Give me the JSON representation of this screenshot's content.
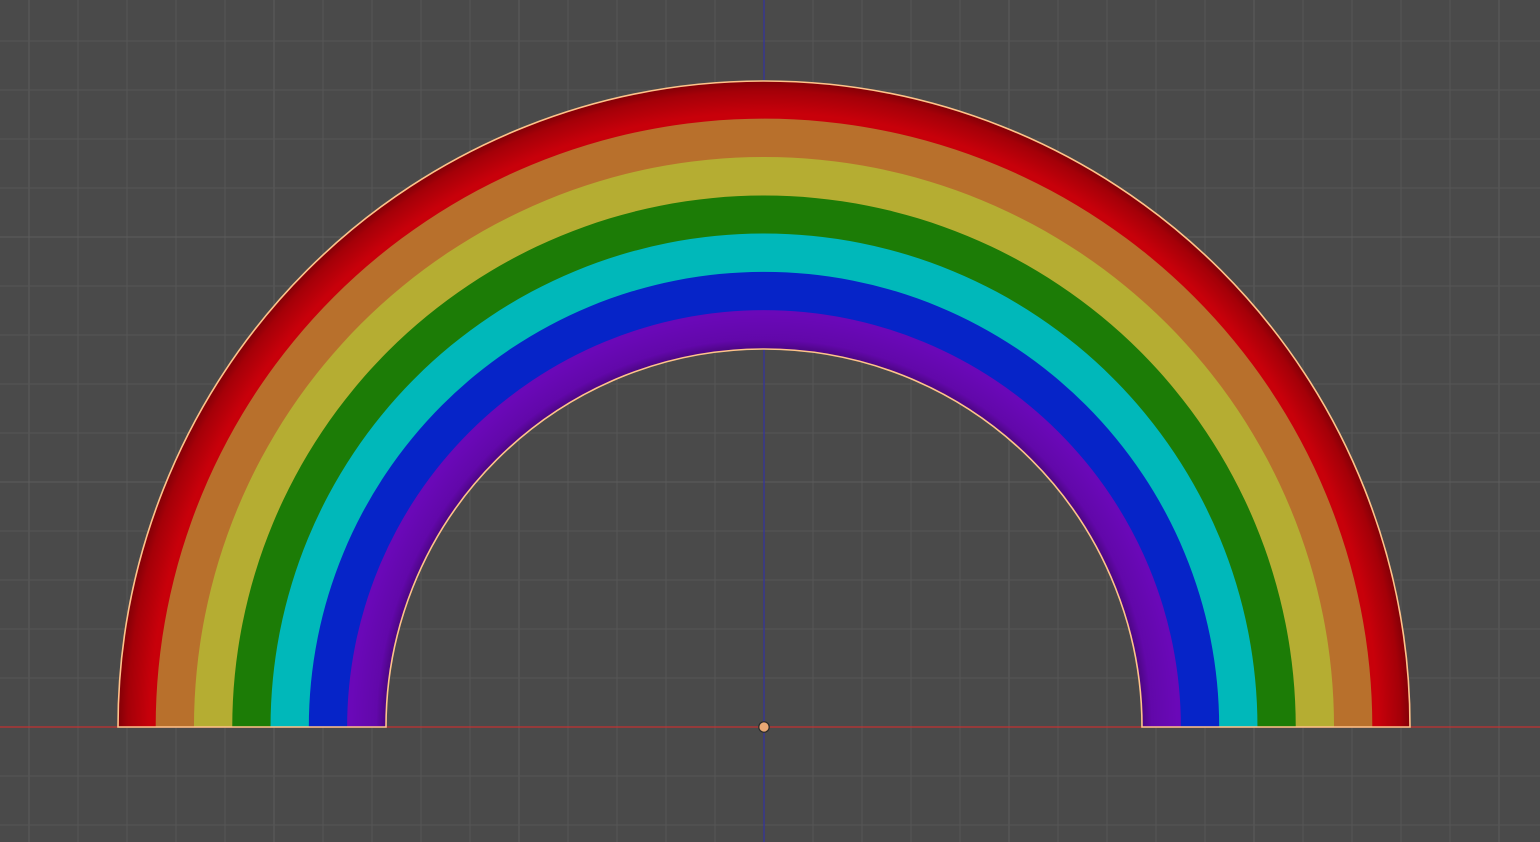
{
  "viewport": {
    "mode": "orthographic-front-view",
    "background_color": "#4a4a4a",
    "grid": {
      "visible": true,
      "minor_color": "#565656",
      "major_color": "#5c5c5c"
    },
    "axes": {
      "x_axis_color": "#c23232",
      "z_axis_color": "#3232a0"
    }
  },
  "scene_object": {
    "name": "",
    "type": "rainbow-arch-mesh",
    "selected": true,
    "outline_color": "#ffc38a",
    "origin_icon": "object-origin-dot",
    "origin_color": "#e8a874",
    "bands": [
      {
        "color_name": "red",
        "color": "#c8000a"
      },
      {
        "color_name": "orange",
        "color": "#b8702c"
      },
      {
        "color_name": "yellow",
        "color": "#b5ad32"
      },
      {
        "color_name": "green",
        "color": "#1c7c06"
      },
      {
        "color_name": "cyan",
        "color": "#00b8ba"
      },
      {
        "color_name": "blue",
        "color": "#0624c8"
      },
      {
        "color_name": "violet",
        "color": "#6a08b8"
      }
    ]
  }
}
